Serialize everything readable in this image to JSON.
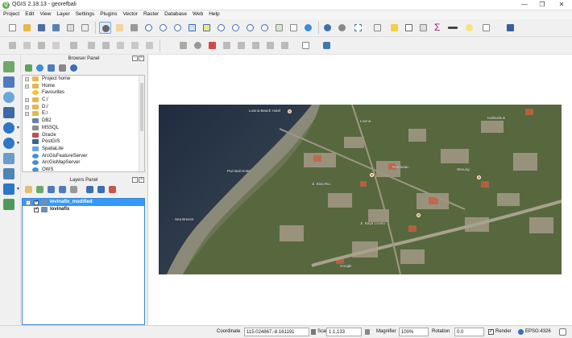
{
  "window": {
    "title": "QGIS 2.18.13 - georefbali",
    "app_icon": "qgis-icon"
  },
  "menu": [
    "Project",
    "Edit",
    "View",
    "Layer",
    "Settings",
    "Plugins",
    "Vector",
    "Raster",
    "Database",
    "Web",
    "Help"
  ],
  "browser_panel": {
    "title": "Browser Panel",
    "items": [
      {
        "label": "Project home",
        "icon": "folder-icon",
        "expandable": true
      },
      {
        "label": "Home",
        "icon": "folder-icon",
        "expandable": true
      },
      {
        "label": "Favourites",
        "icon": "star-icon",
        "expandable": false
      },
      {
        "label": "C:/",
        "icon": "drive-icon",
        "expandable": true
      },
      {
        "label": "D:/",
        "icon": "drive-icon",
        "expandable": true
      },
      {
        "label": "E:/",
        "icon": "drive-icon",
        "expandable": true
      },
      {
        "label": "DB2",
        "icon": "database-icon",
        "expandable": false
      },
      {
        "label": "MSSQL",
        "icon": "database-icon",
        "expandable": false
      },
      {
        "label": "Oracle",
        "icon": "database-icon",
        "expandable": false
      },
      {
        "label": "PostGIS",
        "icon": "elephant-icon",
        "expandable": false
      },
      {
        "label": "SpatiaLite",
        "icon": "feather-icon",
        "expandable": false
      },
      {
        "label": "ArcGisFeatureServer",
        "icon": "globe-icon",
        "expandable": false
      },
      {
        "label": "ArcGisMapServer",
        "icon": "globe-icon",
        "expandable": false
      },
      {
        "label": "OWS",
        "icon": "globe-icon",
        "expandable": false
      }
    ]
  },
  "layers_panel": {
    "title": "Layers Panel",
    "layers": [
      {
        "name": "lovinafix_modified",
        "checked": true,
        "selected": true
      },
      {
        "name": "lovinafix",
        "checked": true,
        "selected": false
      }
    ]
  },
  "map_labels": [
    "Lovina Beach Hotel",
    "Puri Bali Hotel",
    "Lovina",
    "Rambutan",
    "Jl. Bina Ria",
    "Warung",
    "Sea Breeze",
    "Kalibukbuk",
    "Jl. Raya Lovina",
    "Google"
  ],
  "status": {
    "coordinate_label": "Coordinate",
    "coordinate_value": "115.024867,-8.161191",
    "scale_label": "Scale",
    "scale_value": "1:1,133",
    "magnifier_label": "Magnifier",
    "magnifier_value": "100%",
    "rotation_label": "Rotation",
    "rotation_value": "0.0",
    "render_label": "Render",
    "crs_label": "EPSG:4326"
  },
  "colors": {
    "selection": "#3399ff",
    "toolbar_bg": "#f0f0f0"
  }
}
